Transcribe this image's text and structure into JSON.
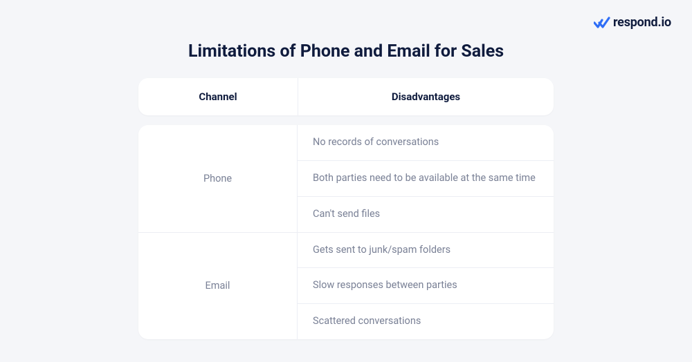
{
  "brand": {
    "name": "respond.io",
    "accent": "#2f6ef6"
  },
  "title": "Limitations of Phone and Email for Sales",
  "headers": {
    "channel": "Channel",
    "disadvantages": "Disadvantages"
  },
  "rows": [
    {
      "channel": "Phone",
      "items": [
        "No records of conversations",
        "Both parties need to be available at the same time",
        "Can't send files"
      ]
    },
    {
      "channel": "Email",
      "items": [
        "Gets sent to junk/spam folders",
        "Slow responses between parties",
        "Scattered conversations"
      ]
    }
  ]
}
